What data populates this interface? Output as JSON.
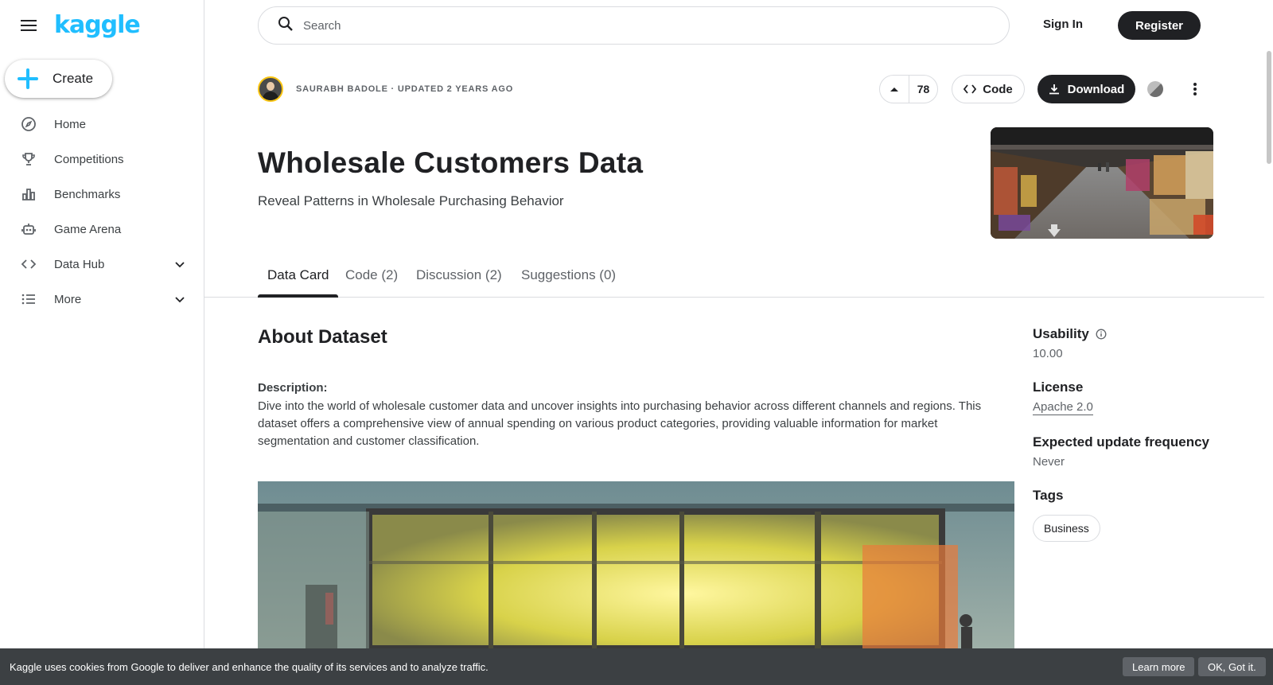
{
  "app": {
    "logo_text": "kaggle",
    "brand_color": "#20beff"
  },
  "sidebar": {
    "menu_icon": "hamburger-menu-icon",
    "create_label": "Create",
    "items": [
      {
        "label": "Home",
        "icon": "compass-icon"
      },
      {
        "label": "Competitions",
        "icon": "trophy-icon"
      },
      {
        "label": "Benchmarks",
        "icon": "bar-chart-icon"
      },
      {
        "label": "Game Arena",
        "icon": "robot-icon"
      },
      {
        "label": "Data Hub",
        "icon": "code-brackets-icon",
        "expandable": true
      },
      {
        "label": "More",
        "icon": "list-icon",
        "expandable": true
      }
    ]
  },
  "header": {
    "search_placeholder": "Search",
    "sign_in": "Sign In",
    "register": "Register"
  },
  "dataset": {
    "byline": "SAURABH BADOLE · UPDATED 2 YEARS AGO",
    "vote_count": "78",
    "code_label": "Code",
    "download_label": "Download",
    "title": "Wholesale Customers Data",
    "subtitle": "Reveal Patterns in Wholesale Purchasing Behavior"
  },
  "tabs": [
    {
      "label": "Data Card",
      "active": true
    },
    {
      "label": "Code (2)",
      "active": false
    },
    {
      "label": "Discussion (2)",
      "active": false
    },
    {
      "label": "Suggestions (0)",
      "active": false
    }
  ],
  "main": {
    "heading": "About Dataset",
    "description_label": "Description:",
    "description_text": "Dive into the world of wholesale customer data and uncover insights into purchasing behavior across different channels and regions. This dataset offers a comprehensive view of annual spending on various product categories, providing valuable information for market segmentation and customer classification."
  },
  "side": {
    "usability_label": "Usability",
    "usability_value": "10.00",
    "license_label": "License",
    "license_value": "Apache 2.0",
    "frequency_label": "Expected update frequency",
    "frequency_value": "Never",
    "tags_label": "Tags",
    "tags": [
      "Business"
    ]
  },
  "cookie": {
    "message": "Kaggle uses cookies from Google to deliver and enhance the quality of its services and to analyze traffic.",
    "learn_more": "Learn more",
    "ok": "OK, Got it."
  }
}
